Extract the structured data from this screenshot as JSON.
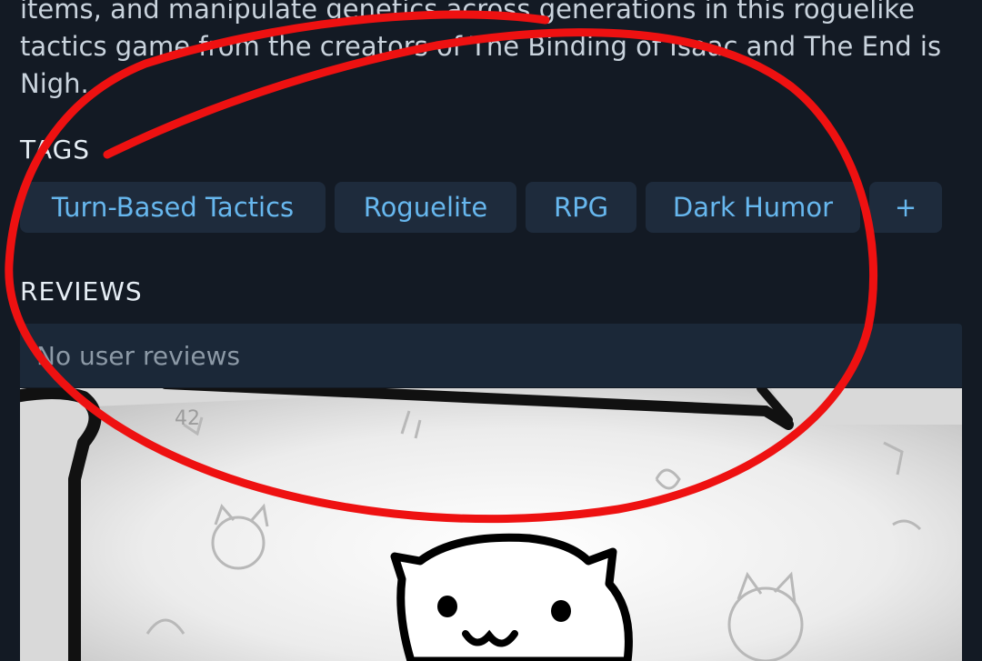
{
  "description": {
    "text": "items, and manipulate genetics across generations in this roguelike tactics game from the creators of The Binding of Isaac and The End is Nigh."
  },
  "tags": {
    "title": "TAGS",
    "items": [
      {
        "label": "Turn-Based Tactics"
      },
      {
        "label": "Roguelite"
      },
      {
        "label": "RPG"
      },
      {
        "label": "Dark Humor"
      }
    ],
    "more_label": "+"
  },
  "reviews": {
    "title": "REVIEWS",
    "empty_text": "No user reviews"
  },
  "screenshot": {
    "subject": "cat-face-drawing"
  },
  "annotation": {
    "type": "red-hand-drawn-circle",
    "color": "#ee1111"
  }
}
